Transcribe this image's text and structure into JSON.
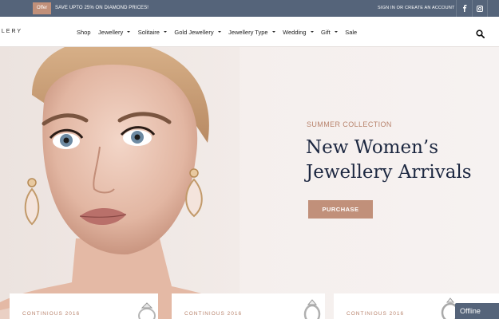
{
  "topbar": {
    "offer_badge": "Offer",
    "offer_text": "SAVE UPTO 25% ON DIAMOND PRICES!",
    "account_link": "SIGN IN OR CREATE AN ACCOUNT",
    "social_icons": [
      "facebook-icon",
      "instagram-icon"
    ]
  },
  "header": {
    "logo_text": "LLERY",
    "nav": [
      {
        "label": "Shop",
        "dropdown": false
      },
      {
        "label": "Jewellery",
        "dropdown": true
      },
      {
        "label": "Solitaire",
        "dropdown": true
      },
      {
        "label": "Gold Jewellery",
        "dropdown": true
      },
      {
        "label": "Jewellery Type",
        "dropdown": true
      },
      {
        "label": "Wedding",
        "dropdown": true
      },
      {
        "label": "Gift",
        "dropdown": true
      },
      {
        "label": "Sale",
        "dropdown": false
      }
    ],
    "search_icon": "search-icon"
  },
  "hero": {
    "eyebrow": "SUMMER COLLECTION",
    "headline_line1": "New Women’s",
    "headline_line2": "Jewellery Arrivals",
    "cta_label": "PURCHASE"
  },
  "cards": [
    {
      "label": "CONTINIOUS 2016"
    },
    {
      "label": "CONTINIOUS 2016"
    },
    {
      "label": "CONTINIOUS 2016"
    }
  ],
  "chat": {
    "status": "Offline"
  },
  "colors": {
    "topbar": "#55647a",
    "accent": "#c1907a",
    "headline": "#1c2740"
  }
}
